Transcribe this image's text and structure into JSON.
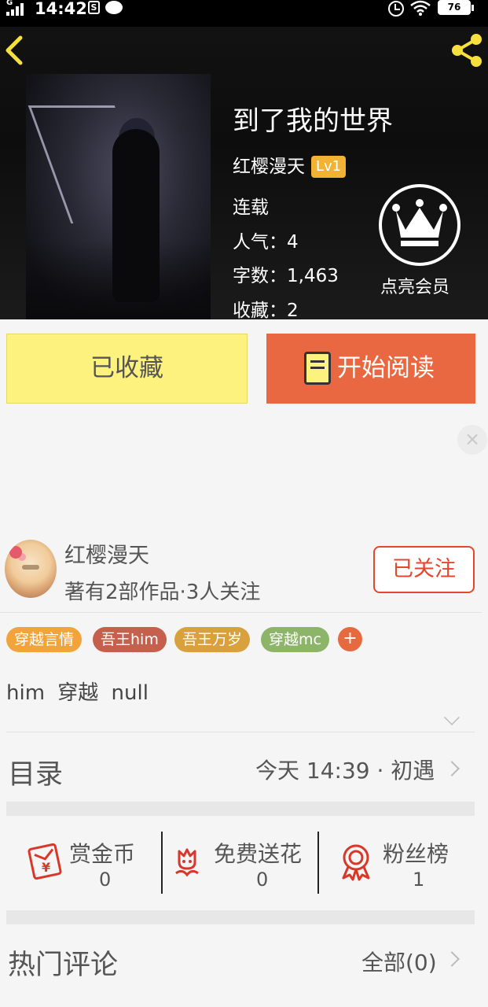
{
  "status_bar": {
    "time": "14:42",
    "network": "G",
    "battery": "76"
  },
  "book": {
    "title": "到了我的世界",
    "author": "红樱漫天",
    "author_level": "Lv1",
    "status": "连载",
    "popularity": "人气：4",
    "word_count": "字数：1,463",
    "favorites": "收藏：2",
    "vip_label": "点亮会员"
  },
  "actions": {
    "favorite_label": "已收藏",
    "read_label": "开始阅读",
    "close_ad": "×"
  },
  "author_card": {
    "name": "红樱漫天",
    "info": "著有2部作品·3人关注",
    "follow_label": "已关注"
  },
  "tags": {
    "items": [
      {
        "label": "穿越言情",
        "color": "#f2a43a"
      },
      {
        "label": "吾王him",
        "color": "#c4604c"
      },
      {
        "label": "吾王万岁",
        "color": "#d9a03e"
      },
      {
        "label": "穿越mc",
        "color": "#8cb56a"
      }
    ],
    "add_label": "+",
    "keywords": "him  穿越  null"
  },
  "catalog": {
    "title": "目录",
    "latest": "今天 14:39 · 初遇"
  },
  "stats": [
    {
      "label": "赏金币",
      "value": "0",
      "icon": "red-envelope-icon"
    },
    {
      "label": "免费送花",
      "value": "0",
      "icon": "flower-icon"
    },
    {
      "label": "粉丝榜",
      "value": "1",
      "icon": "medal-icon"
    }
  ],
  "comments": {
    "title": "热门评论",
    "all_label": "全部(0)"
  }
}
